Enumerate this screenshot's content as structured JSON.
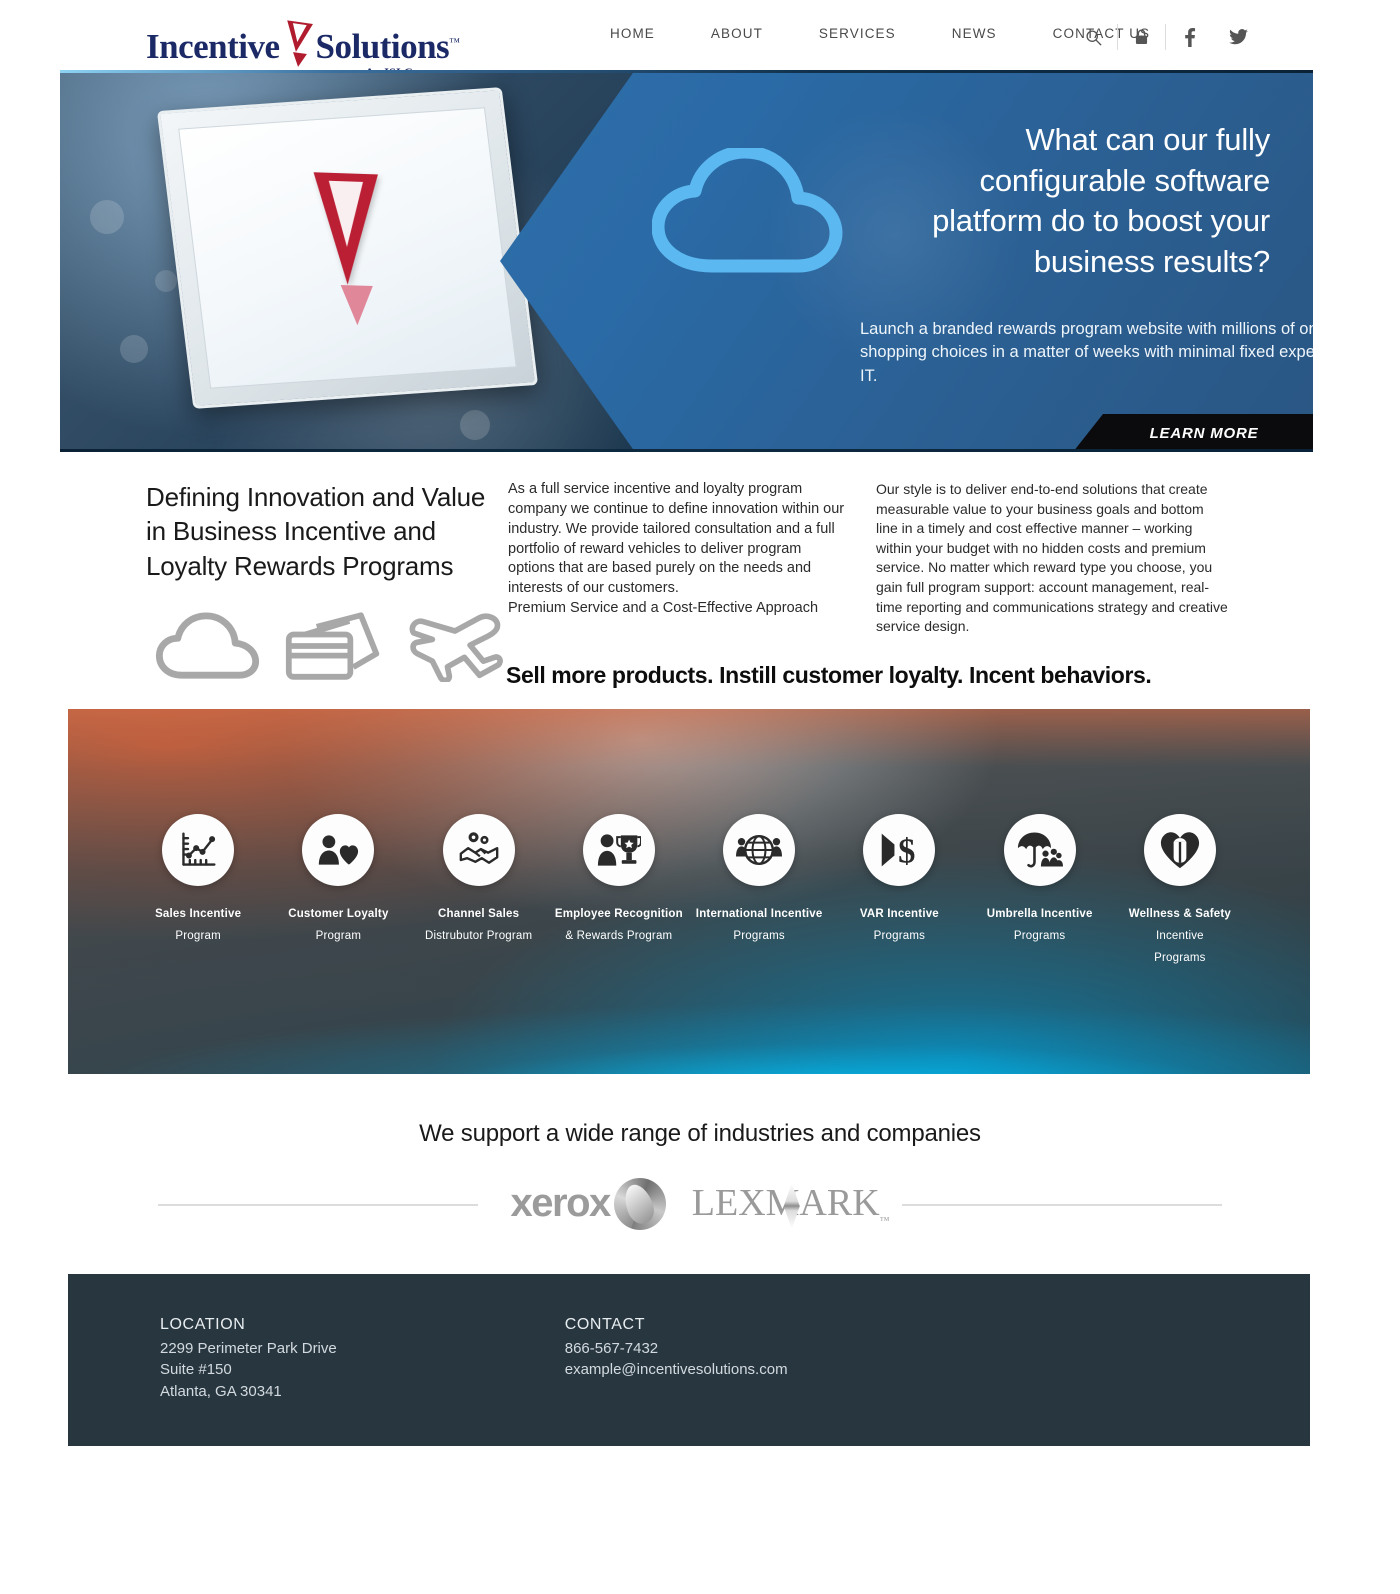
{
  "header": {
    "logo": {
      "word1": "Incentive",
      "word2": "Solutions",
      "tm": "™",
      "tagline": "An ISI Company",
      "mark_icon": "red-exclamation-mark-icon"
    },
    "nav": [
      {
        "label": "HOME",
        "name": "nav-home"
      },
      {
        "label": "ABOUT",
        "name": "nav-about"
      },
      {
        "label": "SERVICES",
        "name": "nav-services"
      },
      {
        "label": "NEWS",
        "name": "nav-news"
      },
      {
        "label": "CONTACT US",
        "name": "nav-contact-us"
      }
    ],
    "icons": [
      {
        "name": "search-icon",
        "label": "Search"
      },
      {
        "name": "lock-icon",
        "label": "Login"
      },
      {
        "name": "facebook-icon",
        "label": "Facebook"
      },
      {
        "name": "twitter-icon",
        "label": "Twitter"
      }
    ]
  },
  "hero": {
    "headline": "What can our fully configurable software platform do to boost your business results?",
    "subtext": "Launch a branded rewards program website with millions of online shopping choices in a matter of weeks with minimal fixed expense and IT.",
    "cta_label": "LEARN MORE",
    "cloud_icon": "blue-cloud-icon",
    "tablet_icon": "tablet-device-image",
    "accent_color": "#2f6da8",
    "cta_bg": "#0b0b0d"
  },
  "intro": {
    "title": "Defining Innovation and Value in Business Incentive and Loyalty Rewards Programs",
    "icons": [
      {
        "name": "cloud-outline-icon",
        "label": "Cloud"
      },
      {
        "name": "gift-cards-outline-icon",
        "label": "Gift Cards"
      },
      {
        "name": "airplane-outline-icon",
        "label": "Travel"
      }
    ],
    "column_1": "As a full service incentive and loyalty program company we continue to define innovation within our industry. We provide tailored consultation and a full portfolio of reward vehicles to deliver program options that are based purely on the needs and interests of our customers.",
    "column_1_extra": "Premium Service and a Cost-Effective Approach",
    "column_2": "Our style is to deliver end-to-end solutions that create measurable value to your business goals and bottom line in a timely and cost effective manner – working within your budget with no hidden costs and premium service. No matter which reward type you choose, you gain full program support: account management, real-time reporting and communications strategy and creative service design.",
    "tagline": "Sell more products. Instill customer loyalty. Incent behaviors."
  },
  "programs": {
    "items": [
      {
        "icon": "sales-chart-icon",
        "line1": "Sales Incentive",
        "line2": "Program"
      },
      {
        "icon": "customer-heart-icon",
        "line1": "Customer Loyalty",
        "line2": "Program"
      },
      {
        "icon": "handshake-gears-icon",
        "line1": "Channel Sales",
        "line2": "Distrubutor Program"
      },
      {
        "icon": "person-trophy-icon",
        "line1": "Employee Recognition",
        "line2": "& Rewards Program"
      },
      {
        "icon": "globe-people-icon",
        "line1": "International Incentive",
        "line2": "Programs"
      },
      {
        "icon": "dollar-arrow-icon",
        "line1": "VAR Incentive",
        "line2": "Programs"
      },
      {
        "icon": "umbrella-people-icon",
        "line1": "Umbrella Incentive",
        "line2": "Programs"
      },
      {
        "icon": "heart-safety-vest-icon",
        "line1": "Wellness & Safety",
        "line2": "Incentive",
        "line3": "Programs"
      }
    ]
  },
  "industries": {
    "title": "We support a wide range of industries and companies",
    "logos": [
      {
        "name": "xerox-logo",
        "label": "xerox"
      },
      {
        "name": "lexmark-logo",
        "label": "LEXMARK"
      }
    ]
  },
  "footer": {
    "location_heading": "LOCATION",
    "address_line_1": "2299 Perimeter Park Drive",
    "address_line_2": "Suite #150",
    "address_line_3": "Atlanta, GA 30341",
    "contact_heading": "CONTACT",
    "phone": "866-567-7432",
    "email": "example@incentivesolutions.com",
    "bg_color": "#27363f"
  }
}
